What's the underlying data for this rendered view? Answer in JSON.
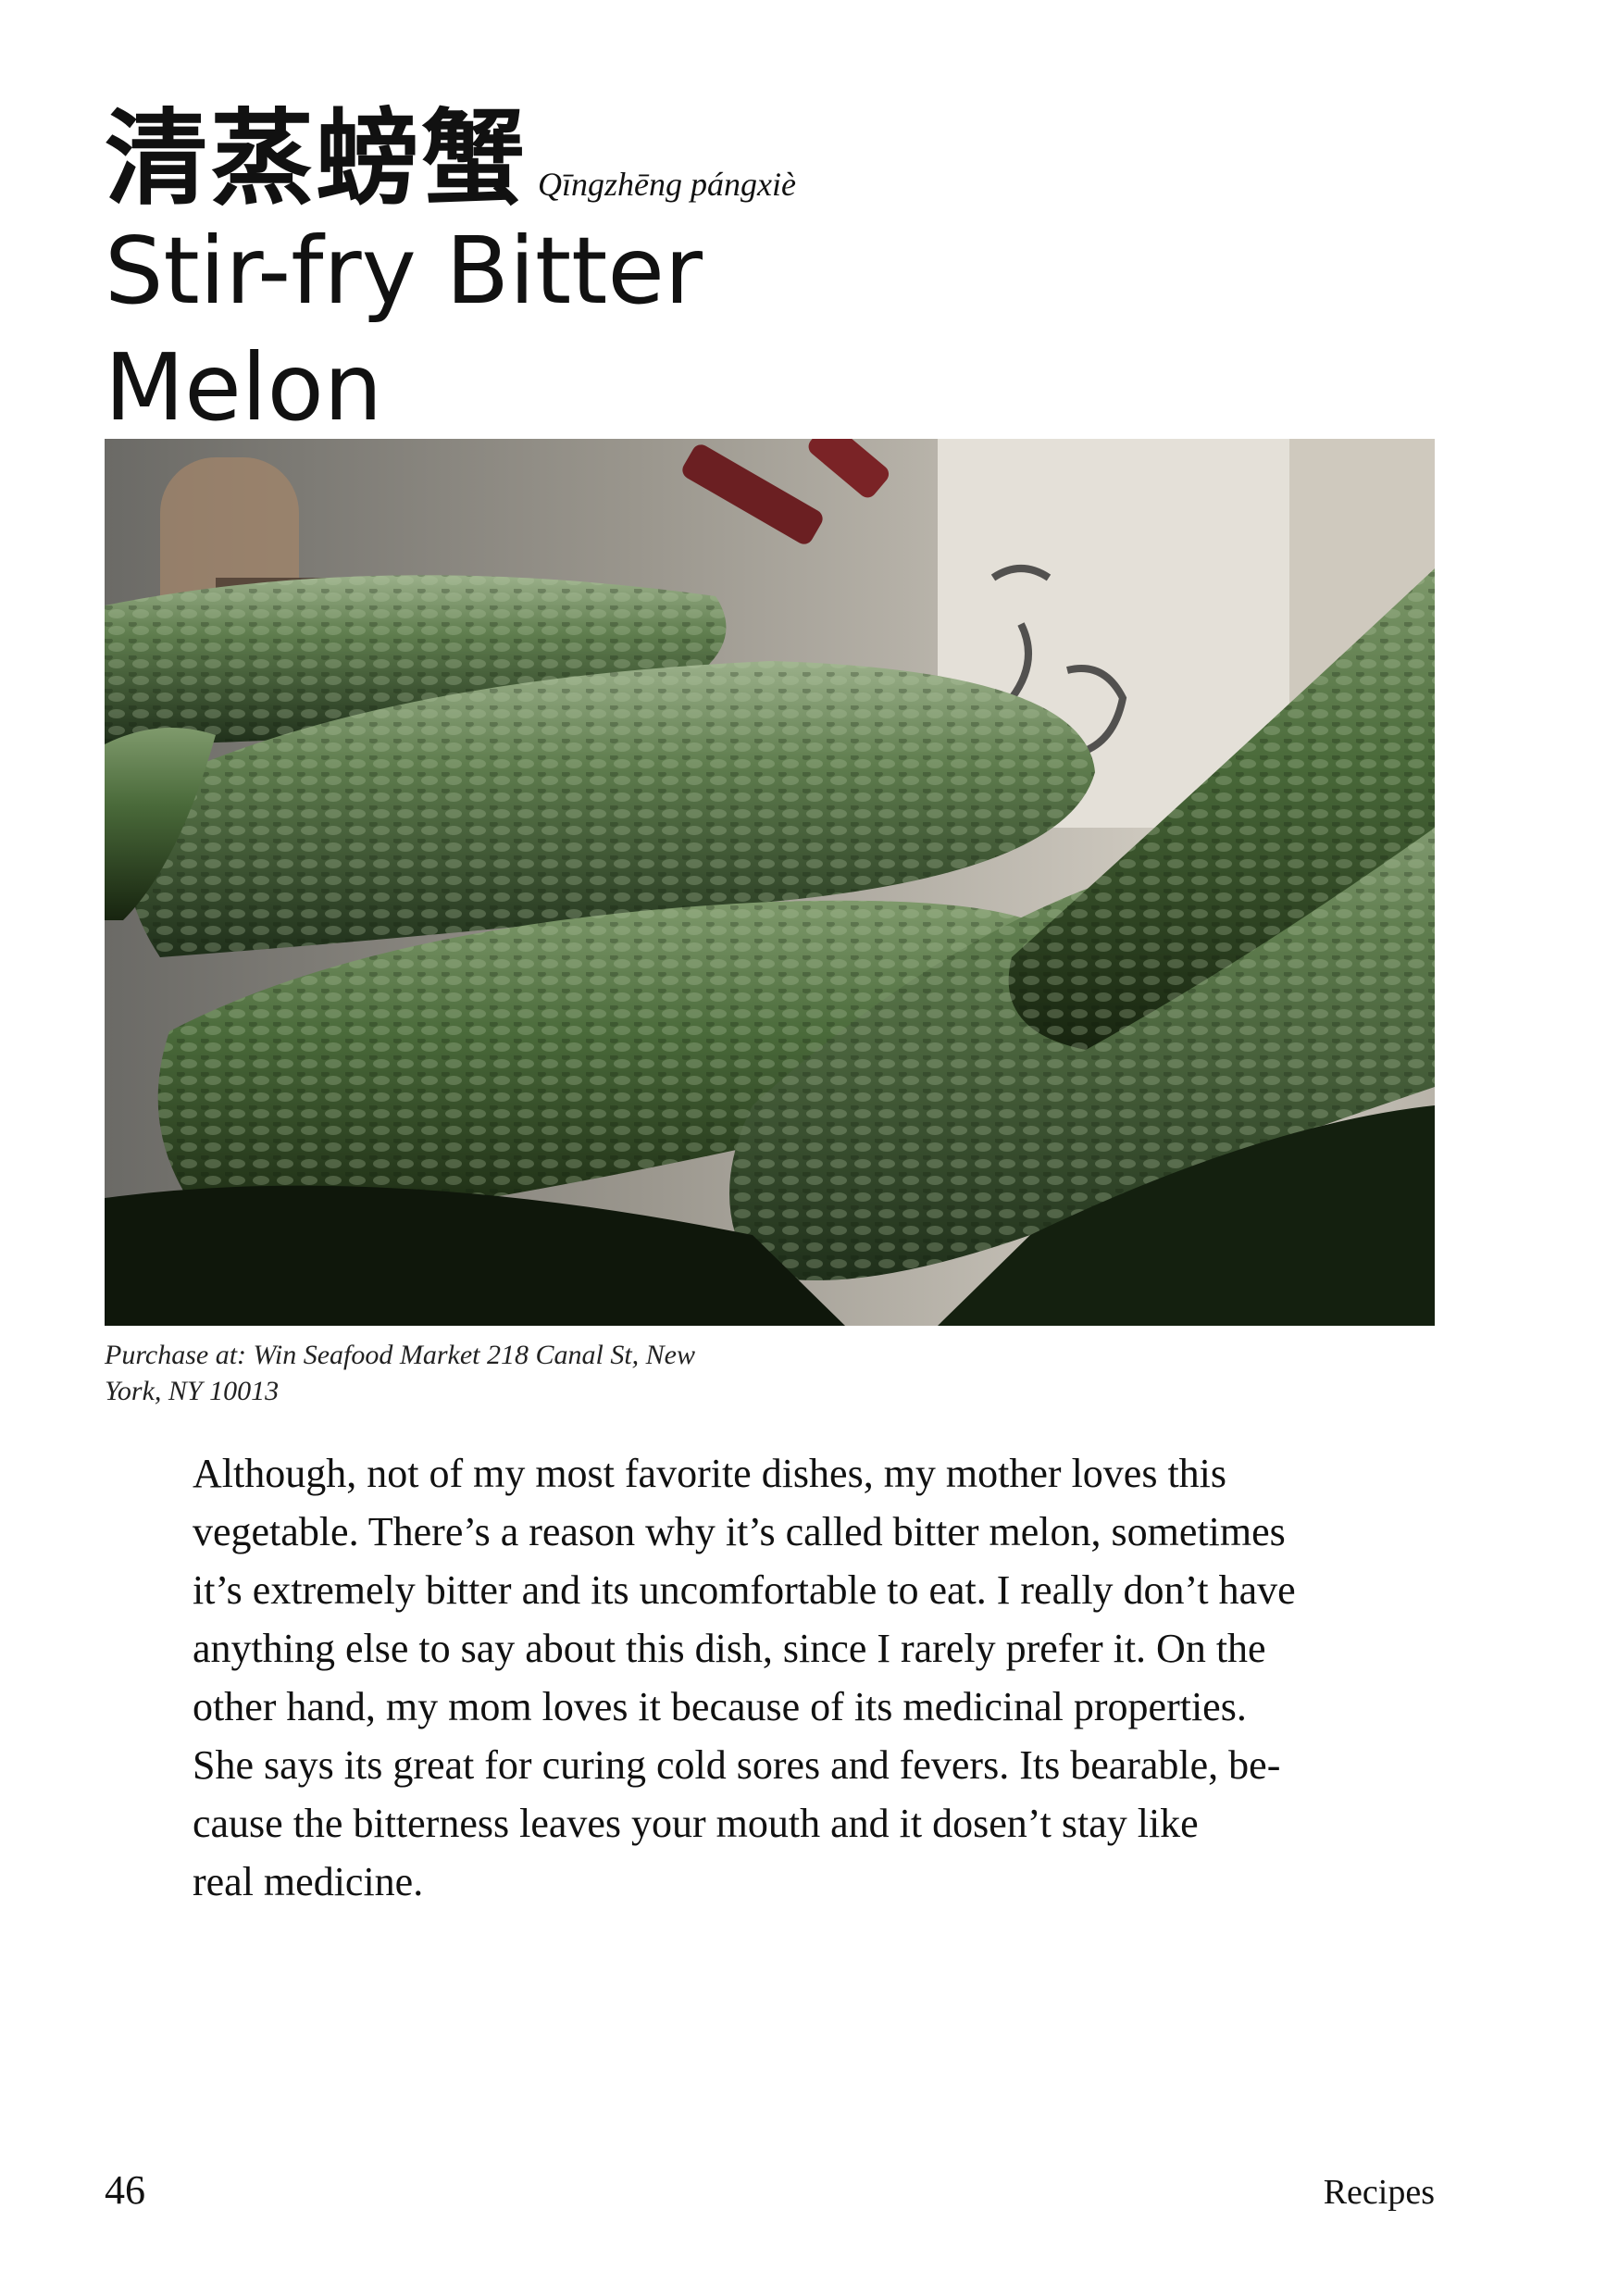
{
  "header": {
    "title_chinese": "清蒸螃蟹",
    "title_pinyin": "Qīngzhēng pángxiè",
    "title_english_line1": "Stir-fry Bitter",
    "title_english_line2": "Melon"
  },
  "photo": {
    "subject": "bitter melons at market stall"
  },
  "caption": {
    "line1": "Purchase at: Win Seafood Market 218 Canal St, New",
    "line2": "York, NY 10013"
  },
  "body": {
    "lines": [
      "Although, not of my most favorite dishes, my mother loves this",
      "vegetable. There’s a reason why it’s called bitter melon, sometimes",
      "it’s extremely bitter and its uncomfortable to eat. I really don’t have",
      "anything else to say about this dish, since I rarely prefer it. On the",
      "other hand, my mom loves it because of its medicinal properties.",
      "She says its great for curing cold sores and fevers. Its bearable, be-",
      "cause the bitterness leaves your mouth and it dosen’t stay like",
      "real medicine."
    ]
  },
  "footer": {
    "page_number": "46",
    "section": "Recipes"
  }
}
